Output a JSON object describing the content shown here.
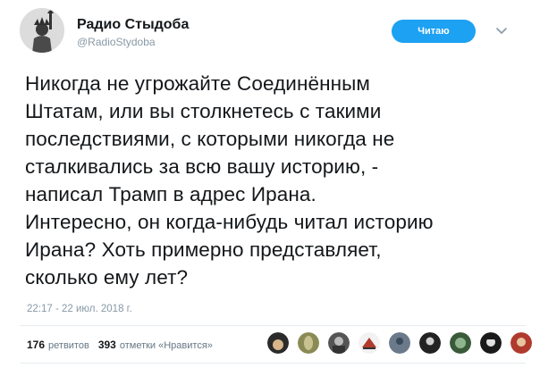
{
  "account": {
    "display_name": "Радио Стыдоба",
    "handle": "@RadioStydoba",
    "avatar_icon": "statue-of-liberty-avatar-icon"
  },
  "follow_button": {
    "label": "Читаю",
    "color": "#1da1f2"
  },
  "menu_icon": "chevron-down-icon",
  "tweet": {
    "lines": [
      "Никогда не угрожайте Соединённым",
      "Штатам, или вы столкнетесь с такими",
      "последствиями, с которыми никогда не",
      "сталкивались за всю вашу историю, -",
      "написал Трамп в адрес Ирана.",
      "Интересно, он когда-нибудь читал историю",
      "Ирана? Хоть примерно представляет,",
      "сколько ему лет?"
    ],
    "timestamp": "22:17 - 22 июл. 2018 г."
  },
  "stats": {
    "retweets_count": "176",
    "retweets_label": "ретвитов",
    "likes_count": "393",
    "likes_label": "отметки «Нравится»"
  },
  "liker_avatars": [
    "avatar-1",
    "avatar-2",
    "avatar-3",
    "avatar-4",
    "avatar-5",
    "avatar-6",
    "avatar-7",
    "avatar-8",
    "avatar-9"
  ]
}
